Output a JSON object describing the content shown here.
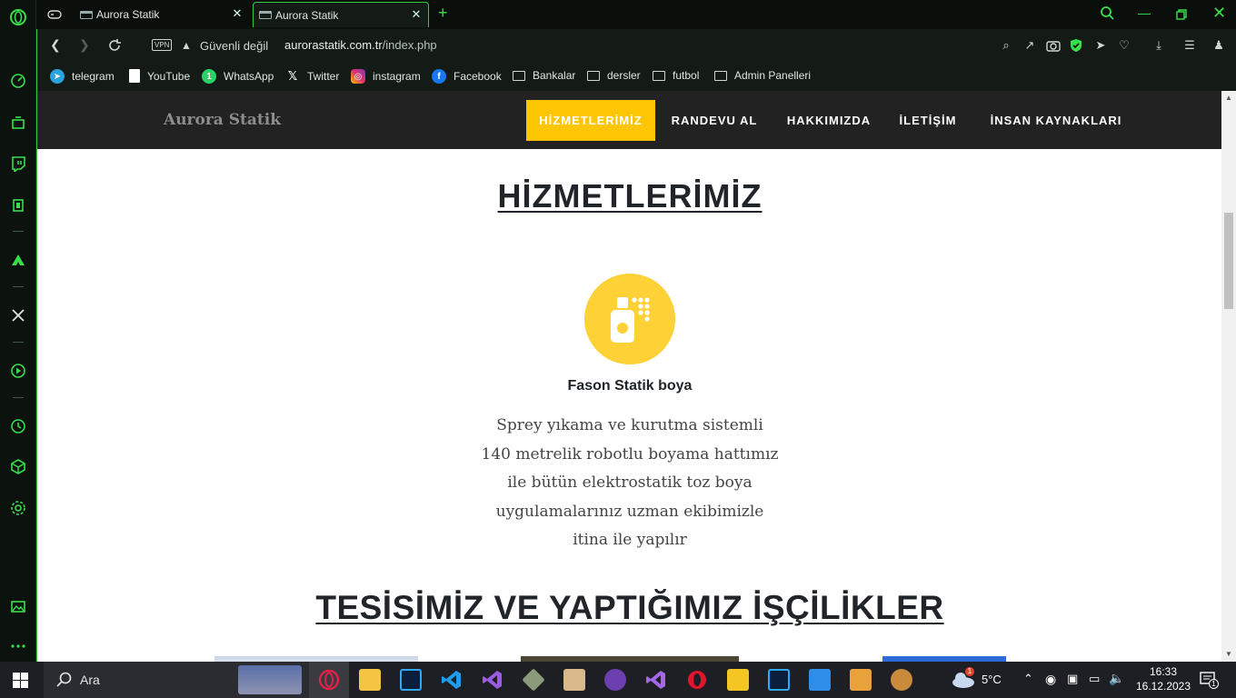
{
  "browser": {
    "tabs": [
      {
        "label": "Aurora Statik",
        "active": false
      },
      {
        "label": "Aurora Statik",
        "active": true
      }
    ],
    "security_text": "Güvenli değil",
    "vpn_label": "VPN",
    "url_domain": "aurorastatik.com.tr",
    "url_path": "/index.php",
    "bookmarks": [
      {
        "label": "telegram",
        "icon": "telegram-icon",
        "color": "#2aa3e0"
      },
      {
        "label": "YouTube",
        "icon": "document-icon",
        "color": "#ffffff"
      },
      {
        "label": "WhatsApp",
        "icon": "whatsapp-icon",
        "color": "#25d366"
      },
      {
        "label": "Twitter",
        "icon": "x-icon",
        "color": "#ffffff"
      },
      {
        "label": "instagram",
        "icon": "instagram-icon",
        "color": "#e1306c"
      },
      {
        "label": "Facebook",
        "icon": "facebook-icon",
        "color": "#1877f2"
      },
      {
        "label": "Bankalar",
        "icon": "folder-icon"
      },
      {
        "label": "dersler",
        "icon": "folder-icon"
      },
      {
        "label": "futbol",
        "icon": "folder-icon"
      },
      {
        "label": "Admin Panelleri",
        "icon": "folder-icon"
      }
    ]
  },
  "site": {
    "brand": "Aurora Statik",
    "menu": [
      {
        "label": "HİZMETLERİMİZ",
        "active": true
      },
      {
        "label": "RANDEVU AL",
        "active": false
      },
      {
        "label": "HAKKIMIZDA",
        "active": false
      },
      {
        "label": "İLETİŞİM",
        "active": false
      },
      {
        "label": "İNSAN KAYNAKLARI",
        "active": false
      }
    ],
    "section_title": "HİZMETLERİMİZ",
    "service": {
      "icon": "spray-paint-icon",
      "title": "Fason Statik boya",
      "description_lines": [
        "Sprey yıkama ve kurutma sistemli",
        "140 metrelik robotlu boyama hattımız",
        "ile bütün elektrostatik toz boya",
        "uygulamalarınız uzman ekibimizle",
        "itina ile yapılır"
      ]
    },
    "section2_title": "TESİSİMİZ VE YAPTIĞIMIZ İŞÇİLİKLER",
    "accent_color": "#fec503",
    "icon_circle_color": "#fed136"
  },
  "taskbar": {
    "search_placeholder": "Ara",
    "weather_temp": "5°C",
    "weather_badge": "1",
    "time": "16:33",
    "date": "16.12.2023",
    "notification_count": "1"
  }
}
